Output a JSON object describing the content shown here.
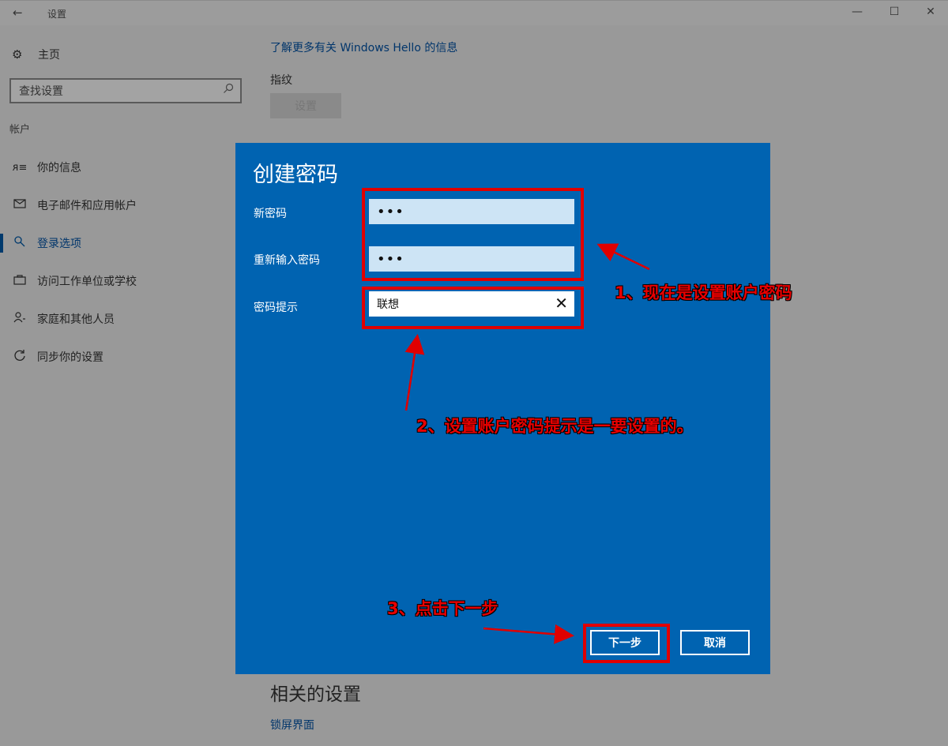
{
  "window": {
    "title": "设置",
    "back_glyph": "←",
    "minimize_glyph": "—",
    "maximize_glyph": "☐",
    "close_glyph": "✕"
  },
  "sidebar": {
    "home_label": "主页",
    "search_placeholder": "查找设置",
    "section_title": "帐户",
    "items": [
      {
        "label": "你的信息",
        "icon": "person-list-icon"
      },
      {
        "label": "电子邮件和应用帐户",
        "icon": "mail-icon"
      },
      {
        "label": "登录选项",
        "icon": "key-icon",
        "active": true
      },
      {
        "label": "访问工作单位或学校",
        "icon": "briefcase-icon"
      },
      {
        "label": "家庭和其他人员",
        "icon": "person-add-icon"
      },
      {
        "label": "同步你的设置",
        "icon": "sync-icon"
      }
    ]
  },
  "content": {
    "hello_link": "了解更多有关 Windows Hello 的信息",
    "fingerprint_label": "指纹",
    "fingerprint_button": "设置",
    "related_title": "相关的设置",
    "lockscreen_link": "锁屏界面"
  },
  "dialog": {
    "title": "创建密码",
    "new_password_label": "新密码",
    "new_password_value": "•••",
    "confirm_password_label": "重新输入密码",
    "confirm_password_value": "•••",
    "hint_label": "密码提示",
    "hint_value": "联想",
    "clear_glyph": "✕",
    "next_button": "下一步",
    "cancel_button": "取消",
    "accent_color": "#0063b1"
  },
  "annotations": {
    "note1": "1、现在是设置账户密码",
    "note2": "2、设置账户密码提示是一要设置的。",
    "note3": "3、点击下一步",
    "color": "#e00000"
  }
}
